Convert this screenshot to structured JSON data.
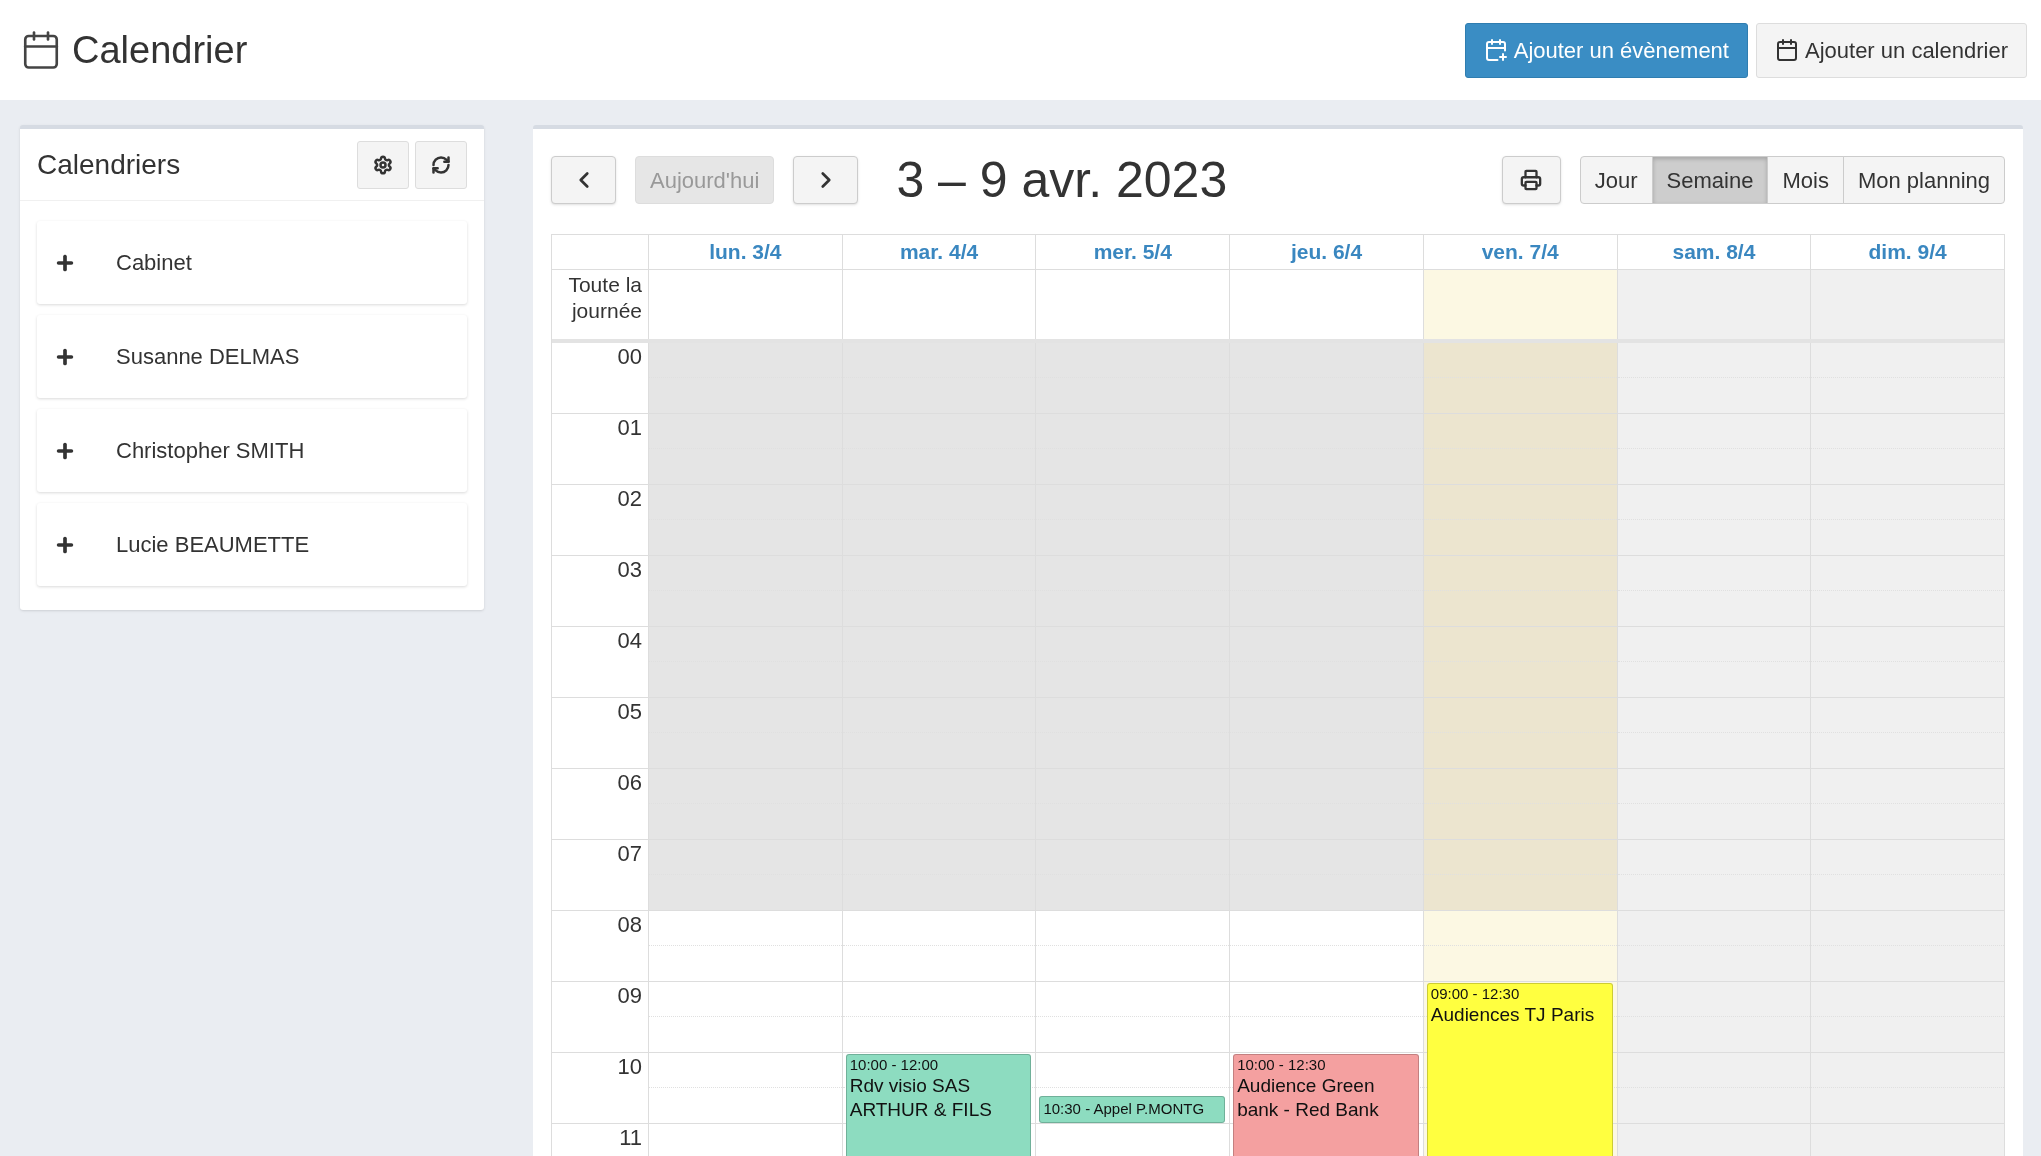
{
  "header": {
    "title": "Calendrier",
    "buttons": [
      {
        "label": "Ajouter un évènement",
        "kind": "primary"
      },
      {
        "label": "Ajouter un calendrier",
        "kind": "default"
      }
    ]
  },
  "sidebar": {
    "title": "Calendriers",
    "items": [
      {
        "label": "Cabinet"
      },
      {
        "label": "Susanne DELMAS"
      },
      {
        "label": "Christopher SMITH"
      },
      {
        "label": "Lucie BEAUMETTE"
      }
    ]
  },
  "toolbar": {
    "today_button": {
      "label": "Aujourd'hui",
      "disabled": true
    },
    "title": "3 – 9 avr. 2023",
    "views": [
      {
        "label": "Jour",
        "selected": false
      },
      {
        "label": "Semaine",
        "selected": true
      },
      {
        "label": "Mois",
        "selected": false
      },
      {
        "label": "Mon planning",
        "selected": false
      }
    ]
  },
  "calendar": {
    "all_day_label": "Toute la journée",
    "days": [
      {
        "label": "lun. 3/4",
        "kind": "weekday"
      },
      {
        "label": "mar. 4/4",
        "kind": "weekday",
        "events": [
          {
            "kind": "block",
            "time": "10:00 - 12:00",
            "title": "Rdv visio SAS ARTHUR & FILS",
            "color": "#8ddcc0"
          }
        ]
      },
      {
        "label": "mer. 5/4",
        "kind": "weekday",
        "events": [
          {
            "kind": "compact",
            "label": "10:30 - Appel P.MONTG",
            "color": "#8ddcc0"
          }
        ]
      },
      {
        "label": "jeu. 6/4",
        "kind": "weekday",
        "events": [
          {
            "kind": "block",
            "time": "10:00 - 12:30",
            "title": "Audience Green bank - Red Bank",
            "color": "#f4a0a0"
          }
        ]
      },
      {
        "label": "ven. 7/4",
        "kind": "today",
        "events": [
          {
            "kind": "block",
            "time": "09:00 - 12:30",
            "title": "Audiences TJ Paris",
            "color": "#ffff40"
          }
        ]
      },
      {
        "label": "sam. 8/4",
        "kind": "weekend"
      },
      {
        "label": "dim. 9/4",
        "kind": "weekend"
      }
    ],
    "hours": [
      {
        "label": "00",
        "off_hours": true
      },
      {
        "label": "01",
        "off_hours": true
      },
      {
        "label": "02",
        "off_hours": true
      },
      {
        "label": "03",
        "off_hours": true
      },
      {
        "label": "04",
        "off_hours": true
      },
      {
        "label": "05",
        "off_hours": true
      },
      {
        "label": "06",
        "off_hours": true
      },
      {
        "label": "07",
        "off_hours": true
      },
      {
        "label": "08",
        "off_hours": false
      },
      {
        "label": "09",
        "off_hours": false
      },
      {
        "label": "10",
        "off_hours": false
      },
      {
        "label": "11",
        "off_hours": false
      }
    ]
  }
}
